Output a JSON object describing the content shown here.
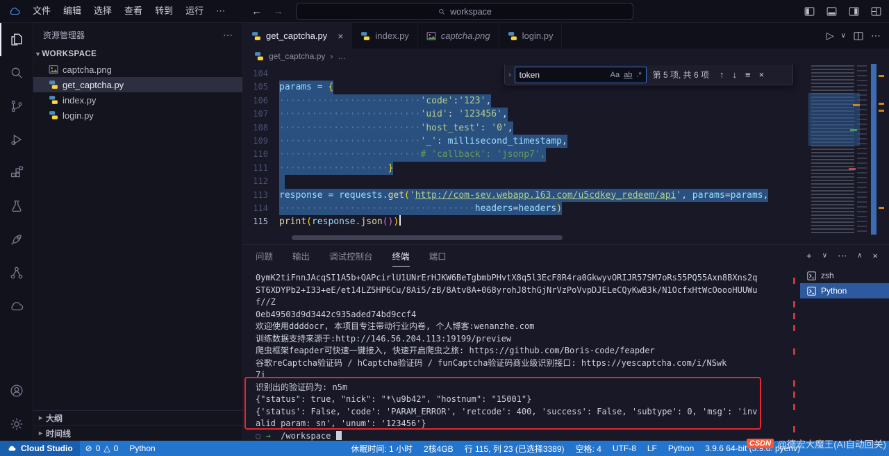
{
  "ui": {
    "close": "×",
    "more": "⋯",
    "ellipsis": "…",
    "run": "▷",
    "dropdown": "∨",
    "maximize": "∧",
    "plus": "+",
    "back": "←",
    "forward": "→",
    "sep": "›",
    "expand": "▾",
    "collapsed": "▸",
    "up": "↑",
    "down": "↓",
    "in_selection": "≡",
    "error": "⊘",
    "warning": "△"
  },
  "titlebar": {
    "menus": [
      "文件",
      "编辑",
      "选择",
      "查看",
      "转到",
      "运行"
    ],
    "search": "workspace"
  },
  "sidebar": {
    "title": "资源管理器",
    "section": "WORKSPACE",
    "files": [
      {
        "name": "captcha.png"
      },
      {
        "name": "get_captcha.py"
      },
      {
        "name": "index.py"
      },
      {
        "name": "login.py"
      }
    ],
    "outline": "大纲",
    "timeline": "时间线"
  },
  "tabs": [
    {
      "name": "get_captcha.py"
    },
    {
      "name": "index.py"
    },
    {
      "name": "captcha.png"
    },
    {
      "name": "login.py"
    }
  ],
  "breadcrumb": {
    "file": "get_captcha.py",
    "more": "…"
  },
  "find": {
    "query": "token",
    "case": "Aa",
    "word": "ab",
    "regex": ".*",
    "results": "第 5 项, 共 6 项"
  },
  "editor": {
    "lines": [
      {
        "num": "104",
        "tokens": []
      },
      {
        "num": "105",
        "sel": true,
        "tokens": [
          [
            "v",
            "params"
          ],
          [
            "o",
            " = "
          ],
          [
            "b1",
            "{"
          ]
        ]
      },
      {
        "num": "106",
        "sel": true,
        "tokens": [
          [
            "ws",
            "··························"
          ],
          [
            "s",
            "'code'"
          ],
          [
            "o",
            ":"
          ],
          [
            "s",
            "'123'"
          ],
          [
            "o",
            ","
          ]
        ]
      },
      {
        "num": "107",
        "sel": true,
        "tokens": [
          [
            "ws",
            "··························"
          ],
          [
            "s",
            "'uid'"
          ],
          [
            "o",
            ": "
          ],
          [
            "s",
            "'123456'"
          ],
          [
            "o",
            ","
          ]
        ]
      },
      {
        "num": "108",
        "sel": true,
        "tokens": [
          [
            "ws",
            "··························"
          ],
          [
            "s",
            "'host_test'"
          ],
          [
            "o",
            ": "
          ],
          [
            "s",
            "'0'"
          ],
          [
            "o",
            ","
          ]
        ]
      },
      {
        "num": "109",
        "sel": true,
        "tokens": [
          [
            "ws",
            "··························"
          ],
          [
            "s",
            "'_'"
          ],
          [
            "o",
            ": "
          ],
          [
            "v",
            "millisecond_timestamp"
          ],
          [
            "o",
            ","
          ]
        ]
      },
      {
        "num": "110",
        "sel": true,
        "tokens": [
          [
            "ws",
            "··························"
          ],
          [
            "c",
            "# 'callback': 'jsonp7',"
          ]
        ]
      },
      {
        "num": "111",
        "sel": true,
        "tokens": [
          [
            "ws",
            "····················"
          ],
          [
            "b1",
            "}"
          ]
        ]
      },
      {
        "num": "112",
        "sel": true,
        "tokens": [
          [
            "ws",
            " "
          ]
        ]
      },
      {
        "num": "113",
        "sel": true,
        "tokens": [
          [
            "v",
            "response"
          ],
          [
            "o",
            " = "
          ],
          [
            "v",
            "requests"
          ],
          [
            "o",
            "."
          ],
          [
            "f",
            "get"
          ],
          [
            "b1",
            "("
          ],
          [
            "s",
            "'"
          ],
          [
            "su",
            "http://com-sev.webapp.163.com/u5cdkey_redeem/api"
          ],
          [
            "s",
            "'"
          ],
          [
            "o",
            ", "
          ],
          [
            "v",
            "params"
          ],
          [
            "o",
            "="
          ],
          [
            "v",
            "params"
          ],
          [
            "o",
            ","
          ]
        ]
      },
      {
        "num": "114",
        "sel": true,
        "tokens": [
          [
            "ws",
            "····································"
          ],
          [
            "v",
            "headers"
          ],
          [
            "o",
            "="
          ],
          [
            "v",
            "headers"
          ],
          [
            "b1",
            ")"
          ]
        ]
      },
      {
        "num": "115",
        "cur": true,
        "cursor": true,
        "tokens": [
          [
            "f",
            "print"
          ],
          [
            "b1",
            "("
          ],
          [
            "v",
            "response"
          ],
          [
            "o",
            "."
          ],
          [
            "f",
            "json"
          ],
          [
            "b2",
            "()"
          ],
          [
            "b1",
            ")"
          ]
        ]
      }
    ]
  },
  "panel": {
    "tabs": [
      "问题",
      "输出",
      "调试控制台",
      "终端",
      "端口"
    ]
  },
  "terminal": {
    "lines": [
      "0ymK2tiFnnJAcqSI1A5b+QAPcirlU1UNrErHJKW6BeTgbmbPHvtX8q5l3EcF8R4ra0GkwyvORIJR57SM7oRs55PQ55Axn8BXns2q",
      "ST6XDYPb2+I33+eE/et14LZ5HP6Cu/8Ai5/zB/8Atv8A+068yrohJ8thGjNrVzPoVvpDJELeCQyKwB3k/N1OcfxHtWcOoooHUUWu",
      "f//Z",
      "0eb49503d9d3442c935aded74bd9ccf4",
      "欢迎使用ddddocr, 本项目专注带动行业内卷, 个人博客:wenanzhe.com",
      "训练数据支持来源于:http://146.56.204.113:19199/preview",
      "爬虫框架feapder可快速一键接入, 快速开启爬虫之旅: https://github.com/Boris-code/feapder",
      "谷歌reCaptcha验证码 / hCaptcha验证码 / funCaptcha验证码商业级识别接口: https://yescaptcha.com/i/NSwk",
      "7i",
      "识别出的验证码为: n5m",
      "{\"status\": true, \"nick\": \"*\\u9b42\", \"hostnum\": \"15001\"}",
      "{'status': False, 'code': 'PARAM_ERROR', 'retcode': 400, 'success': False, 'subtype': 0, 'msg': 'inv",
      "alid param: sn', 'unum': '123456'}",
      {
        "tokens": [
          [
            "dim",
            "○ "
          ],
          [
            "green",
            "→"
          ],
          [
            "plain",
            "  /workspace "
          ]
        ],
        "cursor": true
      }
    ],
    "sessions": [
      {
        "label": "zsh"
      },
      {
        "label": "Python"
      }
    ]
  },
  "statusbar": {
    "brand": "Cloud Studio",
    "errors": "0",
    "warnings": "0",
    "python": "Python",
    "right": [
      "休眠时间: 1 小时",
      "2核4GB",
      "行 115, 列 23 (已选择3389)",
      "空格: 4",
      "UTF-8",
      "LF",
      "Python",
      "3.9.6 64-bit (3.9.6: pyenv)"
    ]
  },
  "watermark": {
    "brand": "CSDN",
    "text": "@德宏大魔王(AI自动回关)"
  }
}
